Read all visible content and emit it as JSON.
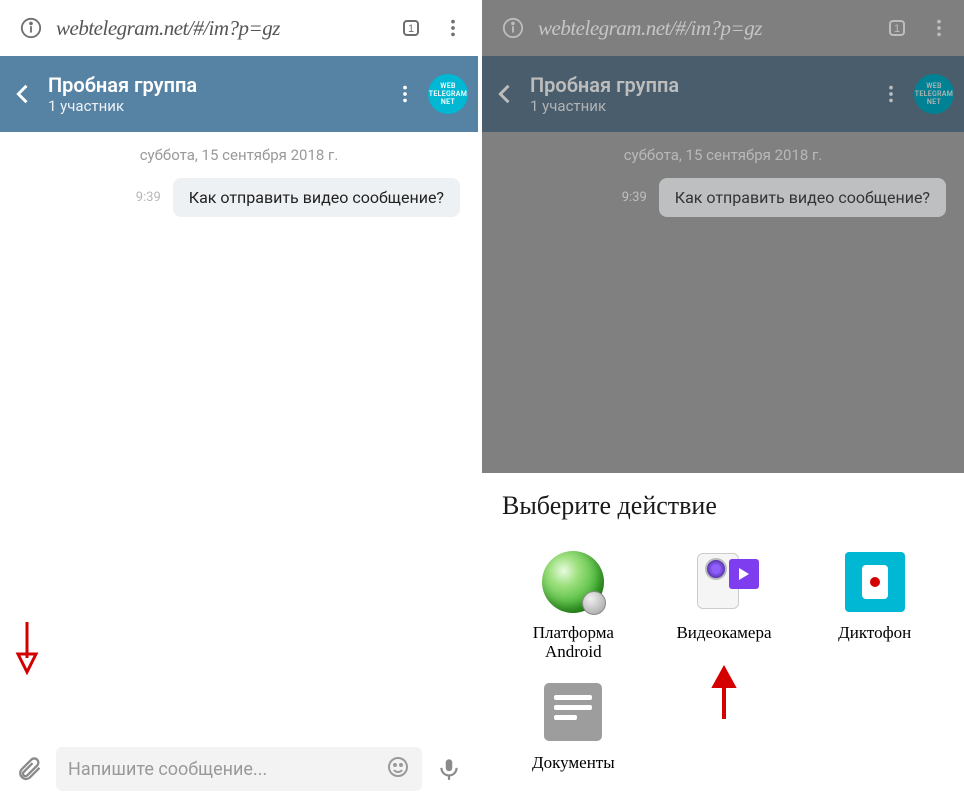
{
  "browser": {
    "url": "webtelegram.net/#/im?p=gz"
  },
  "chat_header": {
    "title": "Пробная группа",
    "subtitle": "1 участник",
    "avatar_lines": [
      "WEB",
      "TELEGRAM",
      "NET"
    ]
  },
  "chat_body": {
    "date": "суббота, 15 сентября 2018 г.",
    "message_time": "9:39",
    "message_text": "Как отправить видео сообщение?"
  },
  "composer": {
    "placeholder": "Напишите сообщение..."
  },
  "sheet": {
    "title": "Выберите действие",
    "apps": [
      {
        "id": "android",
        "label": "Платформа\nAndroid"
      },
      {
        "id": "camcorder",
        "label": "Видеокамера"
      },
      {
        "id": "dictaphone",
        "label": "Диктофон"
      },
      {
        "id": "documents",
        "label": "Документы"
      }
    ]
  }
}
